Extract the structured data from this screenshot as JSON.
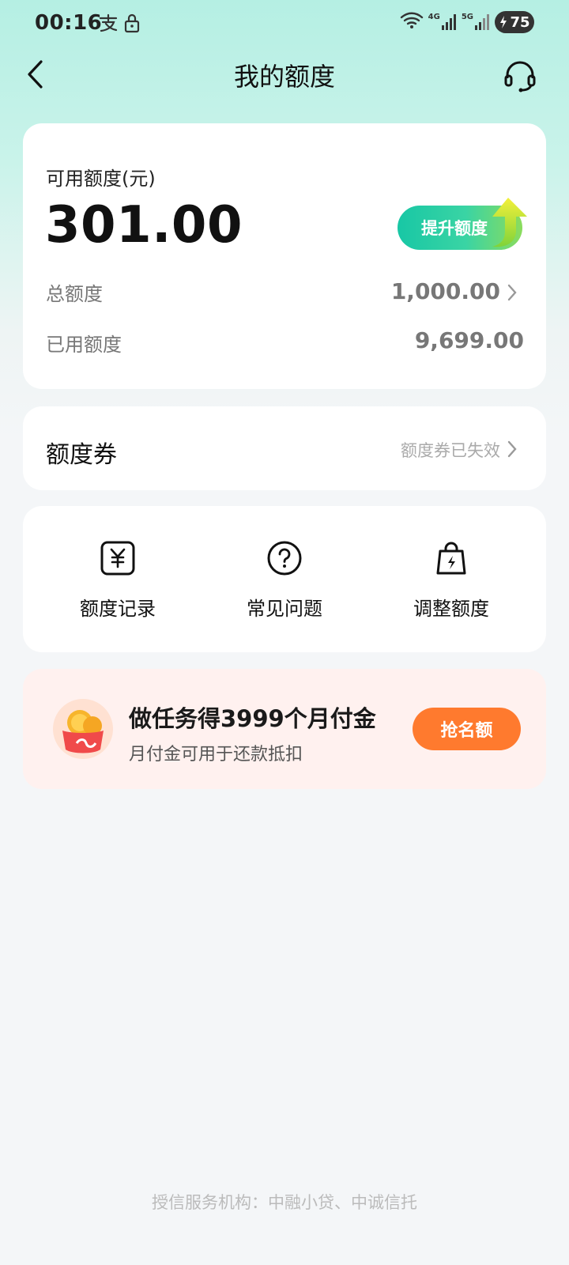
{
  "status_bar": {
    "time": "00:16",
    "network_1": "4G",
    "network_2": "5G",
    "battery": "75"
  },
  "header": {
    "title": "我的额度"
  },
  "credit": {
    "available_label": "可用额度(元)",
    "available_value": "301.00",
    "raise_button": "提升额度",
    "total_label": "总额度",
    "total_value": "1,000.00",
    "used_label": "已用额度",
    "used_value": "9,699.00"
  },
  "coupon": {
    "title": "额度券",
    "status": "额度券已失效"
  },
  "menu": {
    "items": [
      {
        "label": "额度记录",
        "icon": "yuan-note-icon"
      },
      {
        "label": "常见问题",
        "icon": "question-circle-icon"
      },
      {
        "label": "调整额度",
        "icon": "lightning-bag-icon"
      }
    ]
  },
  "promo": {
    "title": "做任务得3999个月付金",
    "subtitle": "月付金可用于还款抵扣",
    "button": "抢名额"
  },
  "footer": {
    "note": "授信服务机构：中融小贷、中诚信托"
  },
  "colors": {
    "accent_green": "#18c7a5",
    "promo_orange": "#ff7a2e",
    "promo_bg": "#fff1ef"
  }
}
